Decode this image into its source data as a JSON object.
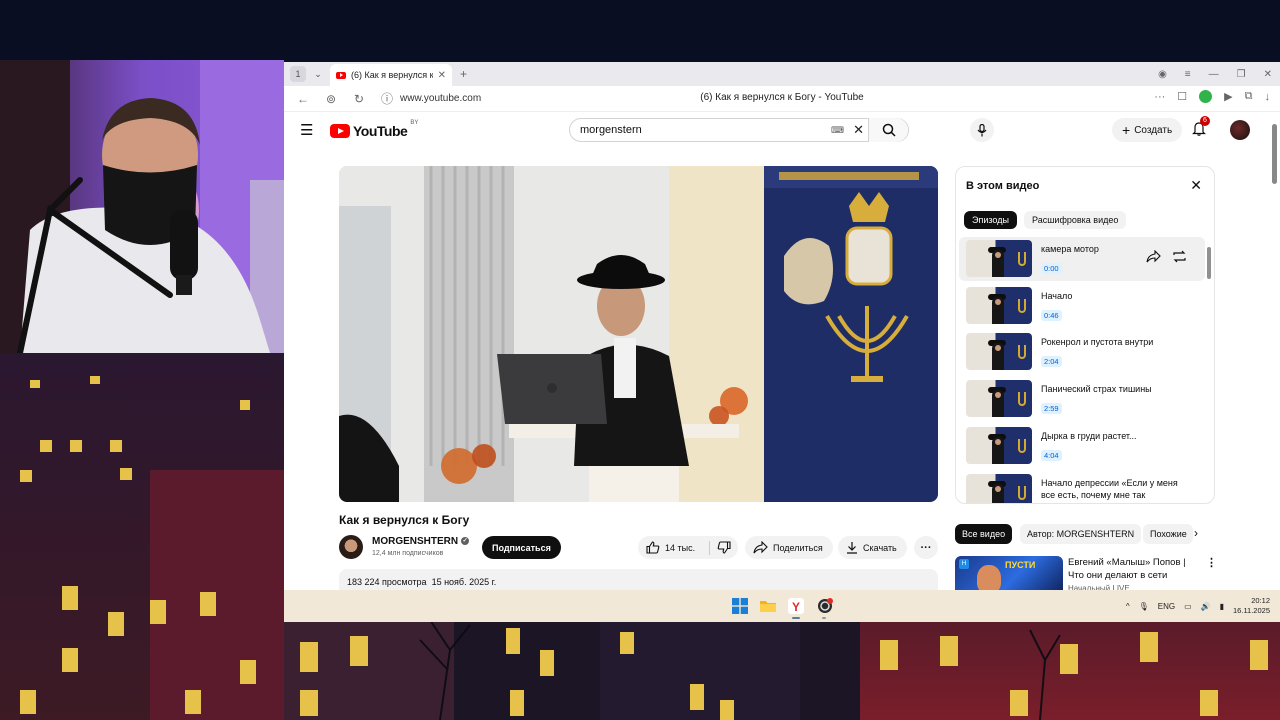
{
  "browser": {
    "tab_count": "1",
    "tab_title": "(6) Как я вернулся к Богу",
    "url": "www.youtube.com",
    "page_title": "(6) Как я вернулся к Богу - YouTube"
  },
  "youtube": {
    "logo_text": "YouTube",
    "region": "BY",
    "search_value": "morgenstern",
    "create_label": "Создать",
    "notification_count": "6"
  },
  "video": {
    "title": "Как я вернулся к Богу",
    "channel": "MORGENSHTERN",
    "subscribers": "12,4 млн подписчиков",
    "subscribe_label": "Подписаться",
    "likes": "14 тыс.",
    "share_label": "Поделиться",
    "download_label": "Скачать",
    "views": "183 224 просмотра",
    "date": "15 нояб. 2025 г."
  },
  "chapters_panel": {
    "title": "В этом видео",
    "tab_episodes": "Эпизоды",
    "tab_transcript": "Расшифровка видео",
    "items": [
      {
        "name": "камера мотор",
        "time": "0:00"
      },
      {
        "name": "Начало",
        "time": "0:46"
      },
      {
        "name": "Рокенрол и пустота внутри",
        "time": "2:04"
      },
      {
        "name": "Панический страх тишины",
        "time": "2:59"
      },
      {
        "name": "Дырка в груди растет...",
        "time": "4:04"
      },
      {
        "name": "Начало депрессии «Если у меня все есть, почему мне так плохо?»",
        "time": ""
      }
    ]
  },
  "related": {
    "chip_all": "Все видео",
    "chip_author": "Автор: MORGENSHTERN",
    "chip_similar": "Похожие",
    "video_title": "Евгений «Малыш» Попов | Что они делают в сети",
    "video_channel": "Начальный LIVE",
    "thumb_text": "ПУСТИ"
  },
  "taskbar": {
    "language": "ENG",
    "time": "20:12",
    "date": "16.11.2025"
  },
  "colors": {
    "youtube_red": "#ff0000",
    "link_blue": "#065fd4",
    "taskbar": "#f1e8d7"
  }
}
